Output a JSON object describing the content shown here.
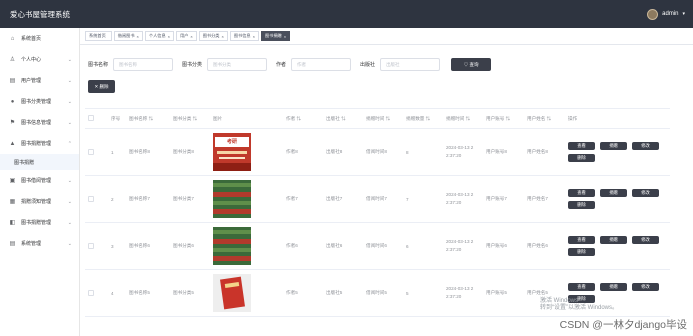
{
  "topbar": {
    "title": "爱心书屋管理系统",
    "user": "admin",
    "caret": "▾"
  },
  "sidebar": {
    "items": [
      {
        "label": "系统首页",
        "icon": "⌂"
      },
      {
        "label": "个人中心",
        "icon": "♙"
      },
      {
        "label": "用户管理",
        "icon": "▤"
      },
      {
        "label": "图书分类管理",
        "icon": "●"
      },
      {
        "label": "图书信息管理",
        "icon": "⚑"
      },
      {
        "label": "图书捐赠管理",
        "icon": "▲"
      },
      {
        "label": "图书捐赠",
        "icon": ""
      },
      {
        "label": "图书借阅管理",
        "icon": "▣"
      },
      {
        "label": "捐赠须知管理",
        "icon": "▦"
      },
      {
        "label": "图书捐赠管理",
        "icon": "◧"
      },
      {
        "label": "系统管理",
        "icon": "▤"
      }
    ]
  },
  "tags": [
    {
      "label": "系统首页",
      "close": ""
    },
    {
      "label": "借阅图书",
      "close": "×"
    },
    {
      "label": "个人信息",
      "close": "×"
    },
    {
      "label": "用户",
      "close": "×"
    },
    {
      "label": "图书分类",
      "close": "×"
    },
    {
      "label": "图书信息",
      "close": "×"
    },
    {
      "label": "图书捐赠",
      "close": "×"
    }
  ],
  "search": {
    "name_label": "图书名称",
    "name_placeholder": "图书名称",
    "category_label": "图书分类",
    "category_placeholder": "图书分类",
    "author_label": "作者",
    "author_placeholder": "作者",
    "publisher_label": "出版社",
    "publisher_placeholder": "出版社",
    "button": "♡ 查询"
  },
  "delete_button": "✕ 删除",
  "table": {
    "headers": [
      "",
      "序号",
      "图书名称 ⇅",
      "图书分类 ⇅",
      "图片",
      "作者 ⇅",
      "出版社 ⇅",
      "捐赠时间 ⇅",
      "捐赠数量 ⇅",
      "捐赠时间 ⇅",
      "用户账号 ⇅",
      "用户姓名 ⇅",
      "操作"
    ],
    "rows": [
      {
        "index": "1",
        "name": "图书名称8",
        "category": "图书分类8",
        "author": "作者8",
        "publisher": "出版社8",
        "donate_date": "借阅时间8",
        "qty": "8",
        "time1": "2024-03-13 2",
        "time2": "2:37:20",
        "account": "用户账号8",
        "username": "用户姓名8",
        "cover": "red"
      },
      {
        "index": "2",
        "name": "图书名称7",
        "category": "图书分类7",
        "author": "作者7",
        "publisher": "出版社7",
        "donate_date": "借阅时间7",
        "qty": "7",
        "time1": "2024-03-13 2",
        "time2": "2:37:20",
        "account": "用户账号7",
        "username": "用户姓名7",
        "cover": "green"
      },
      {
        "index": "3",
        "name": "图书名称6",
        "category": "图书分类6",
        "author": "作者6",
        "publisher": "出版社6",
        "donate_date": "借阅时间6",
        "qty": "6",
        "time1": "2024-03-13 2",
        "time2": "2:37:20",
        "account": "用户账号6",
        "username": "用户姓名6",
        "cover": "green"
      },
      {
        "index": "4",
        "name": "图书名称5",
        "category": "图书分类5",
        "author": "作者5",
        "publisher": "出版社5",
        "donate_date": "借阅时间5",
        "qty": "5",
        "time1": "2024-03-13 2",
        "time2": "2:37:20",
        "account": "用户账号5",
        "username": "用户姓名5",
        "cover": "book"
      }
    ],
    "actions": [
      "查看",
      "捐赠",
      "修改",
      "删除"
    ]
  },
  "watermark": {
    "line1": "激活 Windows",
    "line2": "转到“设置”以激活 Windows。"
  },
  "csdn": "CSDN @一林夕django毕设"
}
